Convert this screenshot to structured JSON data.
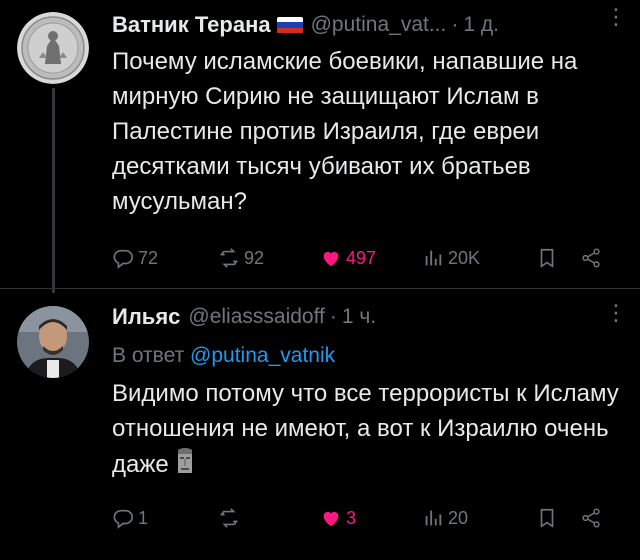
{
  "colors": {
    "background": "#000000",
    "text": "#e7e9ea",
    "muted": "#71767b",
    "link": "#1d9bf0",
    "like_active": "#f91880"
  },
  "tweets": [
    {
      "display_name": "Ватник Терана",
      "has_flag": true,
      "handle": "@putina_vat...",
      "time": "1 д.",
      "text": "Почему исламские боевики, напавшие на мирную Сирию не защищают Ислам в Палестине против Израиля, где евреи десятками тысяч убивают их братьев мусульман?",
      "replies": "72",
      "retweets": "92",
      "likes": "497",
      "views": "20K",
      "liked": true
    },
    {
      "display_name": "Ильяс",
      "handle": "@eliasssaidoff",
      "time": "1 ч.",
      "reply_to_label": "В ответ",
      "reply_to_handle": "@putina_vatnik",
      "text": "Видимо потому что все террористы к Исламу отношения не имеют, а вот к Израилю очень даже",
      "emoji": "moai-emoji",
      "replies": "1",
      "retweets": "",
      "likes": "3",
      "views": "20",
      "liked": true
    }
  ],
  "icons": {
    "reply": "reply-icon",
    "retweet": "retweet-icon",
    "like": "heart-icon",
    "views": "views-icon",
    "bookmark": "bookmark-icon",
    "share": "share-icon",
    "more": "more-icon"
  }
}
